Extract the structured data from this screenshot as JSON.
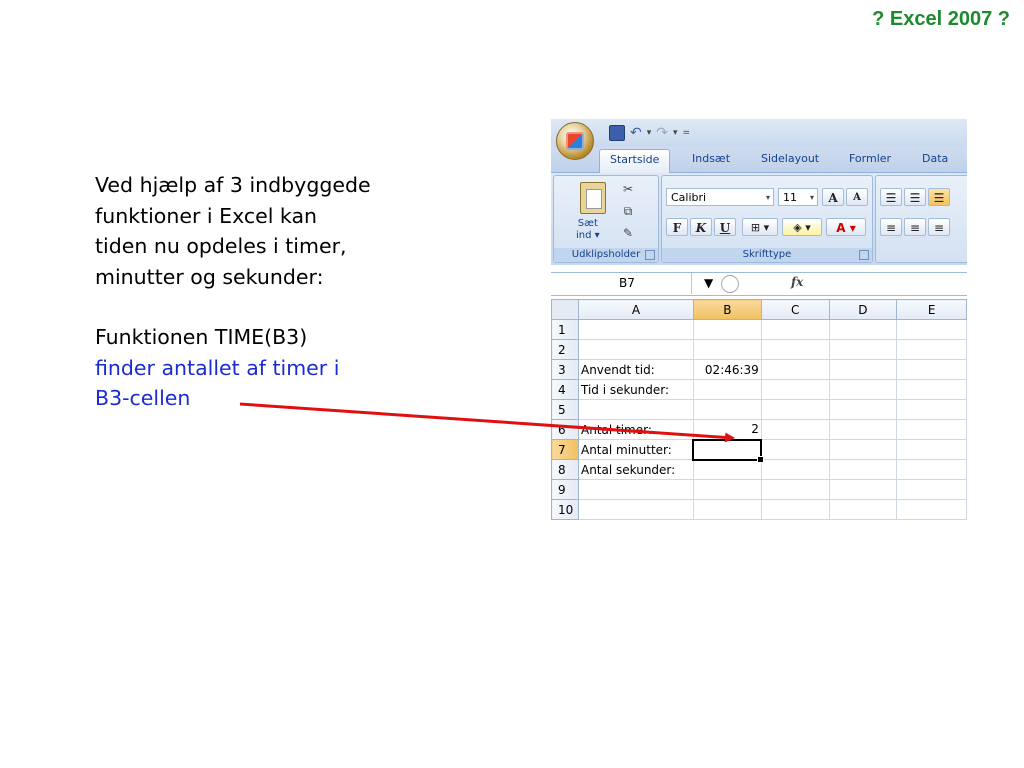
{
  "slide": {
    "title": "? Excel 2007 ?",
    "text_lines_1": [
      "Ved hjælp af 3 indbyggede",
      "funktioner i Excel kan",
      "tiden nu opdeles i timer,",
      "minutter og sekunder:"
    ],
    "text_line_black": "Funktionen TIME(B3)",
    "text_lines_blue": [
      "finder antallet af timer i",
      "B3-cellen"
    ]
  },
  "excel": {
    "qat": {
      "separator": "▾"
    },
    "tabs": [
      "Startside",
      "Indsæt",
      "Sidelayout",
      "Formler",
      "Data"
    ],
    "clipboard": {
      "paste_label_1": "Sæt",
      "paste_label_2": "ind ▾",
      "group_label": "Udklipsholder"
    },
    "font": {
      "name": "Calibri",
      "size": "11",
      "group_label": "Skrifttype",
      "bold": "F",
      "italic": "K",
      "underline": "U",
      "grow": "A",
      "shrink": "A"
    },
    "formula_bar": {
      "cell_ref": "B7",
      "fx": "fx"
    },
    "columns": [
      "A",
      "B",
      "C",
      "D",
      "E"
    ],
    "rows": [
      {
        "n": "1",
        "a": "",
        "b": ""
      },
      {
        "n": "2",
        "a": "",
        "b": ""
      },
      {
        "n": "3",
        "a": "Anvendt tid:",
        "b": "02:46:39"
      },
      {
        "n": "4",
        "a": "Tid i sekunder:",
        "b": ""
      },
      {
        "n": "5",
        "a": "",
        "b": ""
      },
      {
        "n": "6",
        "a": "Antal timer:",
        "b": "2"
      },
      {
        "n": "7",
        "a": "Antal minutter:",
        "b": ""
      },
      {
        "n": "8",
        "a": "Antal sekunder:",
        "b": ""
      },
      {
        "n": "9",
        "a": "",
        "b": ""
      },
      {
        "n": "10",
        "a": "",
        "b": ""
      }
    ],
    "selected_cell": "B7"
  },
  "colors": {
    "title": "#1d8a2e",
    "blue_text": "#1a2bd1",
    "arrow": "#e01010"
  }
}
